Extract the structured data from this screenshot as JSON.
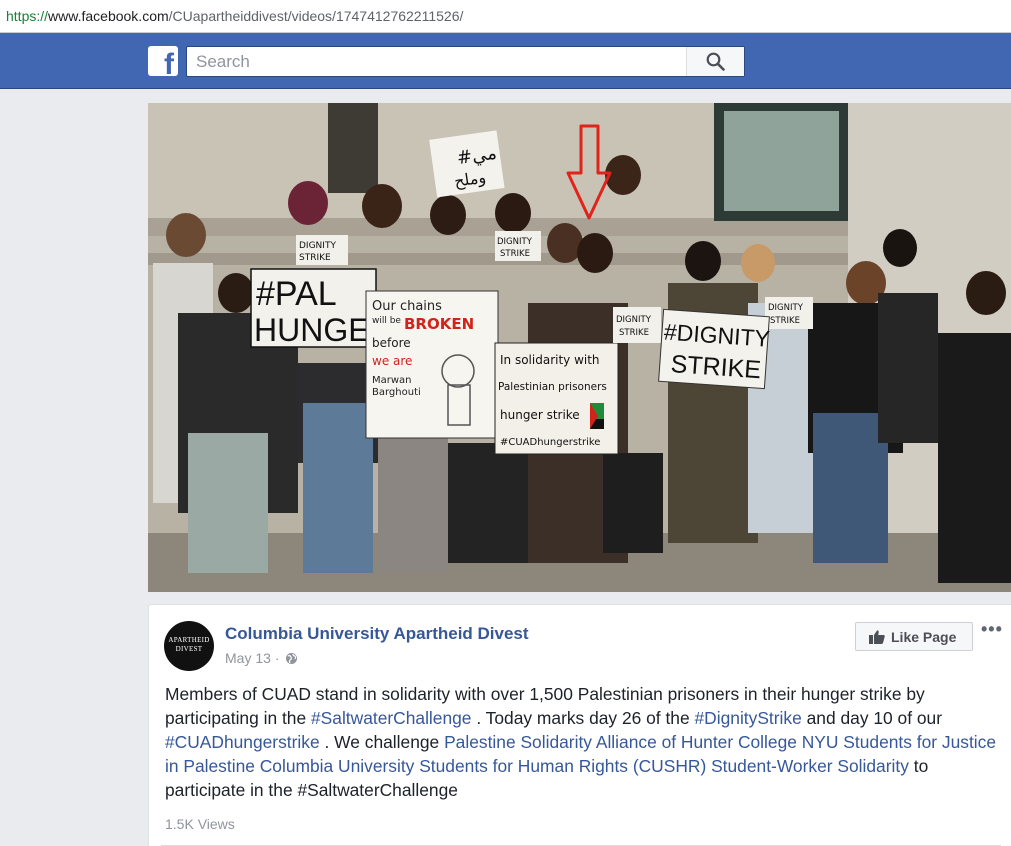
{
  "browser": {
    "url_scheme": "https://",
    "url_host": "www.facebook.com",
    "url_path": "/CUapartheiddivest/videos/1747412762211526/"
  },
  "header": {
    "logo_letter": "f",
    "search_placeholder": "Search"
  },
  "video": {
    "signs": {
      "pal_hunger_1": "#PAL",
      "pal_hunger_2": "HUNGER",
      "dignity_strike_1": "#DIGNITY",
      "dignity_strike_2": "STRIKE",
      "dignity_small_1": "DIGNITY",
      "dignity_small_2": "STRIKE",
      "chains_1": "Our chains",
      "chains_2": "will be",
      "chains_3": "BROKEN",
      "chains_4": "before",
      "chains_5": "we are",
      "chains_6": "Marwan",
      "chains_7": "Barghouti",
      "solidarity_1": "In solidarity with",
      "solidarity_2": "Palestinian prisoners",
      "solidarity_3": "hunger strike",
      "solidarity_4": "#CUADhungerstrike",
      "arabic_1": "#مي",
      "arabic_2": "وملح"
    },
    "arrow_color": "#e0241b"
  },
  "post": {
    "avatar_text_1": "APARTHEID",
    "avatar_text_2": "DIVEST",
    "page_name": "Columbia University Apartheid Divest",
    "date": "May 13",
    "separator": "·",
    "like_page_label": "Like Page",
    "more_label": "•••",
    "text_1": "Members of CUAD stand in solidarity with over 1,500 Palestinian prisoners in their hunger strike by participating in the",
    "hashtag_saltwater": "#SaltwaterChallenge",
    "text_2": ". Today marks day 26 of the",
    "hashtag_dignity": "#DignityStrike",
    "text_3": "and day 10 of our",
    "hashtag_cuad": "#CUADhungerstrike",
    "text_4": ". We challenge",
    "mentions": "Palestine Solidarity Alliance of Hunter College NYU Students for Justice in Palestine Columbia University Students for Human Rights (CUSHR) Student-Worker Solidarity",
    "text_5": "to participate in the #SaltwaterChallenge",
    "views": "1.5K Views"
  },
  "colors": {
    "fb_blue": "#4267b2",
    "link_blue": "#365899"
  }
}
